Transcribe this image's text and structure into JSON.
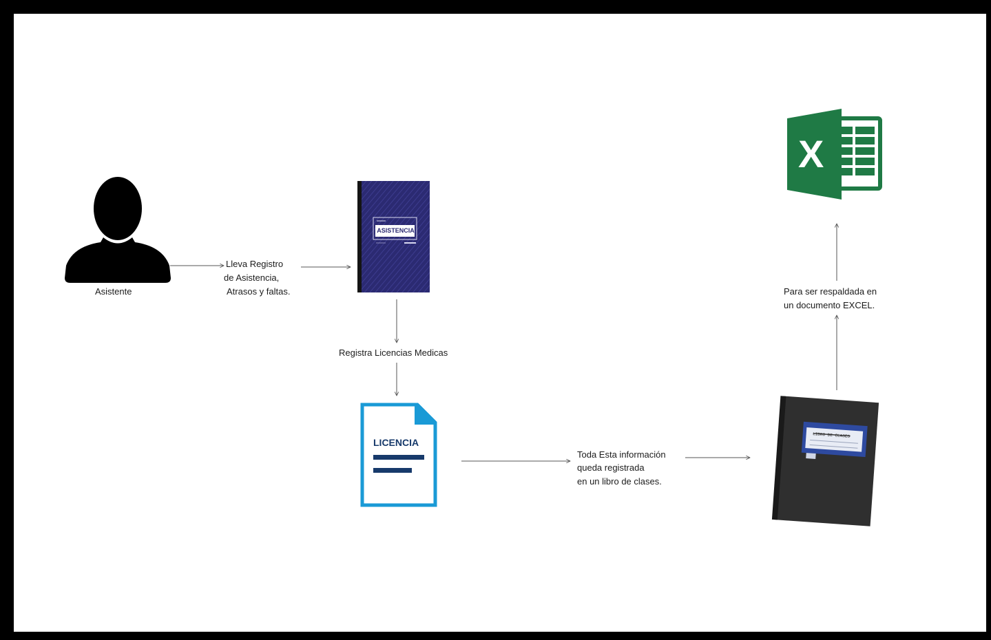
{
  "nodes": {
    "asistente": {
      "label": "Asistente",
      "icon": "person-silhouette-icon"
    },
    "asistencia_book": {
      "label": "ASISTENCIA",
      "icon": "attendance-book-icon",
      "color": "#2a2a6e"
    },
    "licencia_doc": {
      "label": "LICENCIA",
      "icon": "medical-license-document-icon",
      "color": "#1a9ad6"
    },
    "libro_clases": {
      "label": "LIBRO DE CLASES",
      "icon": "class-book-icon",
      "color": "#2b2b2b"
    },
    "excel": {
      "label": "X",
      "icon": "excel-logo-icon",
      "color": "#1f7a45"
    }
  },
  "edges": {
    "registro": {
      "lines": [
        "Lleva Registro",
        "de Asistencia,",
        "Atrasos y faltas."
      ]
    },
    "licencias": {
      "lines": [
        "Registra Licencias Medicas"
      ]
    },
    "libro": {
      "lines": [
        "Toda Esta información",
        "queda registrada",
        "en  un libro de clases."
      ]
    },
    "respaldo": {
      "lines": [
        "Para ser respaldada en",
        "un documento EXCEL."
      ]
    }
  }
}
